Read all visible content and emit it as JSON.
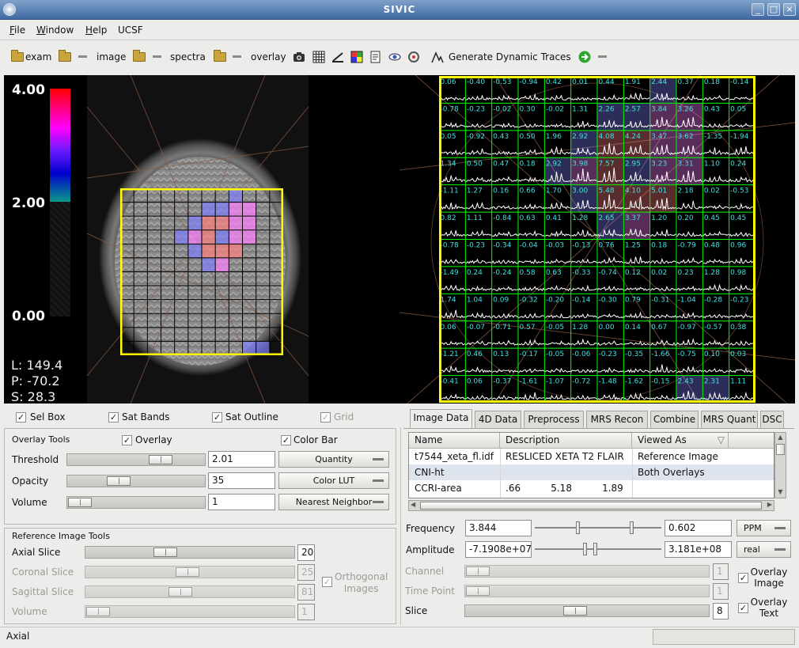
{
  "window": {
    "title": "SIVIC"
  },
  "menu": [
    {
      "label": "File",
      "mnemonic": "F",
      "rest": "ile"
    },
    {
      "label": "Window",
      "mnemonic": "W",
      "rest": "indow"
    },
    {
      "label": "Help",
      "mnemonic": "H",
      "rest": "elp"
    },
    {
      "label": "UCSF",
      "mnemonic": "",
      "rest": "UCSF"
    }
  ],
  "toolbar": {
    "exam_label": "exam",
    "image_label": "image",
    "spectra_label": "spectra",
    "overlay_label": "overlay",
    "dynamic_traces_label": "Generate Dynamic Traces"
  },
  "viewer": {
    "colorbar_max": "4.00",
    "colorbar_mid": "2.00",
    "colorbar_min": "0.00",
    "coord_l": "L: 149.4",
    "coord_p": "P: -70.2",
    "coord_s": "S: 28.3",
    "overlay_colors": {
      "red": "#ff8080",
      "pink": "#ff80ff",
      "blue": "#8080ff",
      "grid": "#000000",
      "box": "#ffff00",
      "spec_grid": "#00ff00",
      "spec_text": "#40e0e0"
    },
    "spectra_values": [
      [
        "0.06",
        "-0.40",
        "-0.53",
        "-0.94",
        "0.42",
        "0.01",
        "0.44",
        "1.91",
        "2.44",
        "0.37",
        "0.18",
        "-0.14"
      ],
      [
        "-0.78",
        "-0.23",
        "-0.02",
        "0.30",
        "-0.02",
        "1.31",
        "2.26",
        "2.57",
        "3.84",
        "3.26",
        "0.43",
        "0.05"
      ],
      [
        "0.05",
        "-0.92",
        "0.43",
        "0.50",
        "1.96",
        "2.92",
        "4.08",
        "4.24",
        "3.47",
        "3.62",
        "-1.35",
        "-1.94"
      ],
      [
        "1.34",
        "0.50",
        "0.47",
        "0.18",
        "2.92",
        "3.98",
        "7.57",
        "2.95",
        "3.23",
        "3.31",
        "1.10",
        "0.24"
      ],
      [
        "-1.11",
        "1.27",
        "0.16",
        "0.66",
        "1.70",
        "3.00",
        "5.48",
        "4.10",
        "5.01",
        "2.18",
        "0.02",
        "-0.53"
      ],
      [
        "0.82",
        "1.11",
        "-0.84",
        "0.63",
        "0.41",
        "1.28",
        "2.65",
        "3.37",
        "1.20",
        "0.20",
        "0.45",
        "0.45"
      ],
      [
        "-0.78",
        "-0.23",
        "-0.34",
        "-0.04",
        "-0.03",
        "-0.13",
        "0.76",
        "1.25",
        "0.18",
        "-0.79",
        "0.48",
        "0.96"
      ],
      [
        "-1.49",
        "0.24",
        "-0.24",
        "0.58",
        "0.63",
        "-0.33",
        "-0.74",
        "0.12",
        "0.02",
        "0.23",
        "1.28",
        "0.98"
      ],
      [
        "1.74",
        "1.04",
        "0.09",
        "-0.32",
        "-0.20",
        "-0.14",
        "-0.30",
        "0.79",
        "-0.31",
        "-1.04",
        "-0.28",
        "-0.23"
      ],
      [
        "0.06",
        "-0.07",
        "-0.71",
        "0.57",
        "-0.05",
        "1.28",
        "0.00",
        "0.14",
        "0.67",
        "-0.97",
        "-0.57",
        "0.38"
      ],
      [
        "-1.21",
        "0.46",
        "0.13",
        "-0.17",
        "-0.05",
        "-0.06",
        "-0.23",
        "-0.35",
        "-1.66",
        "-0.75",
        "0.10",
        "0.03"
      ],
      [
        "-0.41",
        "0.06",
        "-0.37",
        "-1.61",
        "-1.07",
        "-0.72",
        "-1.48",
        "-1.62",
        "-0.15",
        "2.43",
        "2.31",
        "1.11"
      ]
    ]
  },
  "view_options": {
    "sel_box": "Sel Box",
    "sat_bands": "Sat Bands",
    "sat_outline": "Sat Outline",
    "grid": "Grid"
  },
  "overlay_tools": {
    "title": "Overlay Tools",
    "overlay_checkbox": "Overlay",
    "color_bar_checkbox": "Color Bar",
    "threshold_label": "Threshold",
    "threshold_value": "2.01",
    "threshold_level": 0.73,
    "opacity_label": "Opacity",
    "opacity_value": "35",
    "opacity_level": 0.35,
    "volume_label": "Volume",
    "volume_value": "1",
    "volume_level": 0.0,
    "quantity_label": "Quantity",
    "color_lut_label": "Color LUT",
    "interpolation_label": "Nearest Neighbor"
  },
  "reference_tools": {
    "title": "Reference Image Tools",
    "axial_label": "Axial Slice",
    "axial_value": "20",
    "axial_level": 0.37,
    "coronal_label": "Coronal Slice",
    "coronal_value": "25",
    "coronal_level": 0.49,
    "sagittal_label": "Sagittal Slice",
    "sagittal_value": "81",
    "sagittal_level": 0.45,
    "volume_label": "Volume",
    "volume_value": "1",
    "volume_level": 0.0,
    "orthogonal_line1": "Orthogonal",
    "orthogonal_line2": "Images"
  },
  "tabs": [
    "Image Data",
    "4D Data",
    "Preprocess",
    "MRS Recon",
    "Combine",
    "MRS Quant",
    "DSC"
  ],
  "data_table": {
    "headers": [
      "Name",
      "Description",
      "Viewed As"
    ],
    "rows": [
      {
        "name": "t7544_xeta_fl.idf",
        "description": "RESLICED XETA T2 FLAIR",
        "viewed_as": "Reference Image"
      },
      {
        "name": "CNI-ht",
        "description": "",
        "viewed_as": "Both Overlays"
      },
      {
        "name": "CCRI-area",
        "description": ".66          5.18          1.89",
        "viewed_as": ""
      }
    ]
  },
  "spectra_controls": {
    "frequency_label": "Frequency",
    "frequency_min": "3.844",
    "frequency_max": "0.602",
    "frequency_unit": "PPM",
    "amplitude_label": "Amplitude",
    "amplitude_min": "-7.1908e+07",
    "amplitude_max": "3.181e+08",
    "amplitude_mode": "real",
    "channel_label": "Channel",
    "channel_value": "1",
    "timepoint_label": "Time Point",
    "timepoint_value": "1",
    "slice_label": "Slice",
    "slice_value": "8",
    "slice_level": 0.45,
    "overlay_image_line1": "Overlay",
    "overlay_image_line2": "Image",
    "overlay_text_line1": "Overlay",
    "overlay_text_line2": "Text"
  },
  "status": {
    "text": "Axial"
  }
}
